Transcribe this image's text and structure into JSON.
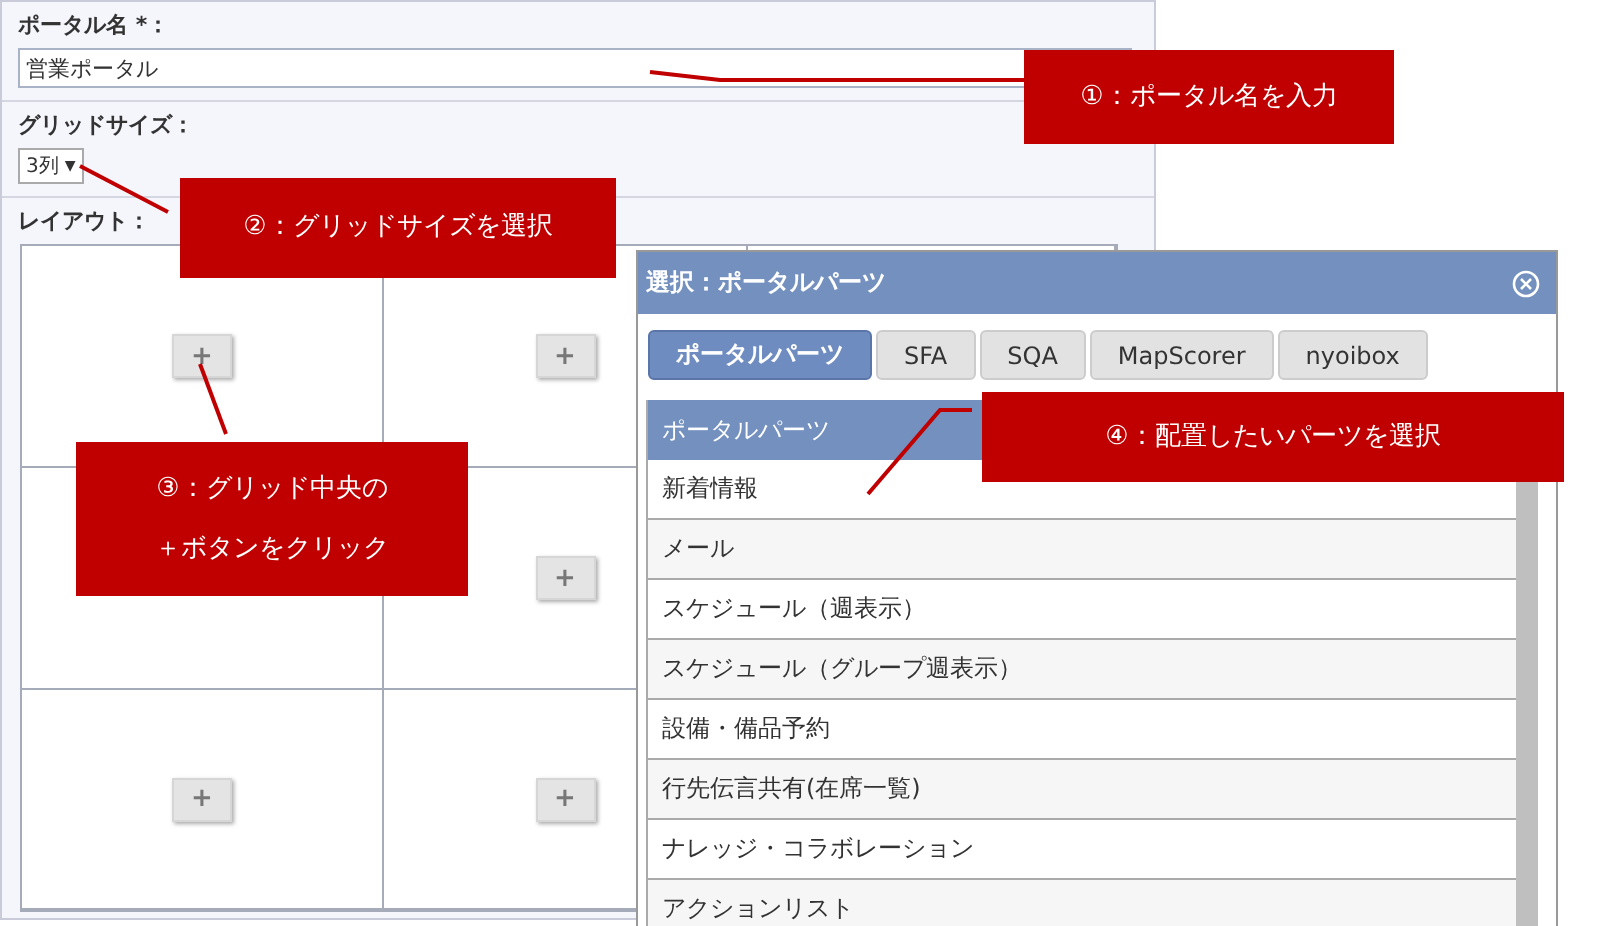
{
  "portal_name": {
    "label": "ポータル名 *：",
    "value": "営業ポータル"
  },
  "grid_size": {
    "label": "グリッドサイズ：",
    "value": "3列",
    "caret": "▼"
  },
  "layout": {
    "label": "レイアウト：",
    "rows": [
      [
        "+",
        "+",
        null
      ],
      [
        null,
        "+",
        null
      ],
      [
        "+",
        "+",
        null
      ]
    ]
  },
  "dialog": {
    "title": "選択：ポータルパーツ",
    "tabs": [
      {
        "label": "ポータルパーツ",
        "selected": true
      },
      {
        "label": "SFA",
        "selected": false
      },
      {
        "label": "SQA",
        "selected": false
      },
      {
        "label": "MapScorer",
        "selected": false
      },
      {
        "label": "nyoibox",
        "selected": false
      }
    ],
    "list": {
      "header": "ポータルパーツ",
      "items": [
        "新着情報",
        "メール",
        "スケジュール（週表示）",
        "スケジュール（グループ週表示）",
        "設備・備品予約",
        "行先伝言共有(在席一覧)",
        "ナレッジ・コラボレーション",
        "アクションリスト"
      ]
    }
  },
  "callouts": [
    "①：ポータル名を入力",
    "②：グリッドサイズを選択",
    "③：グリッド中央の＋ボタンをクリック",
    "④：配置したいパーツを選択"
  ]
}
